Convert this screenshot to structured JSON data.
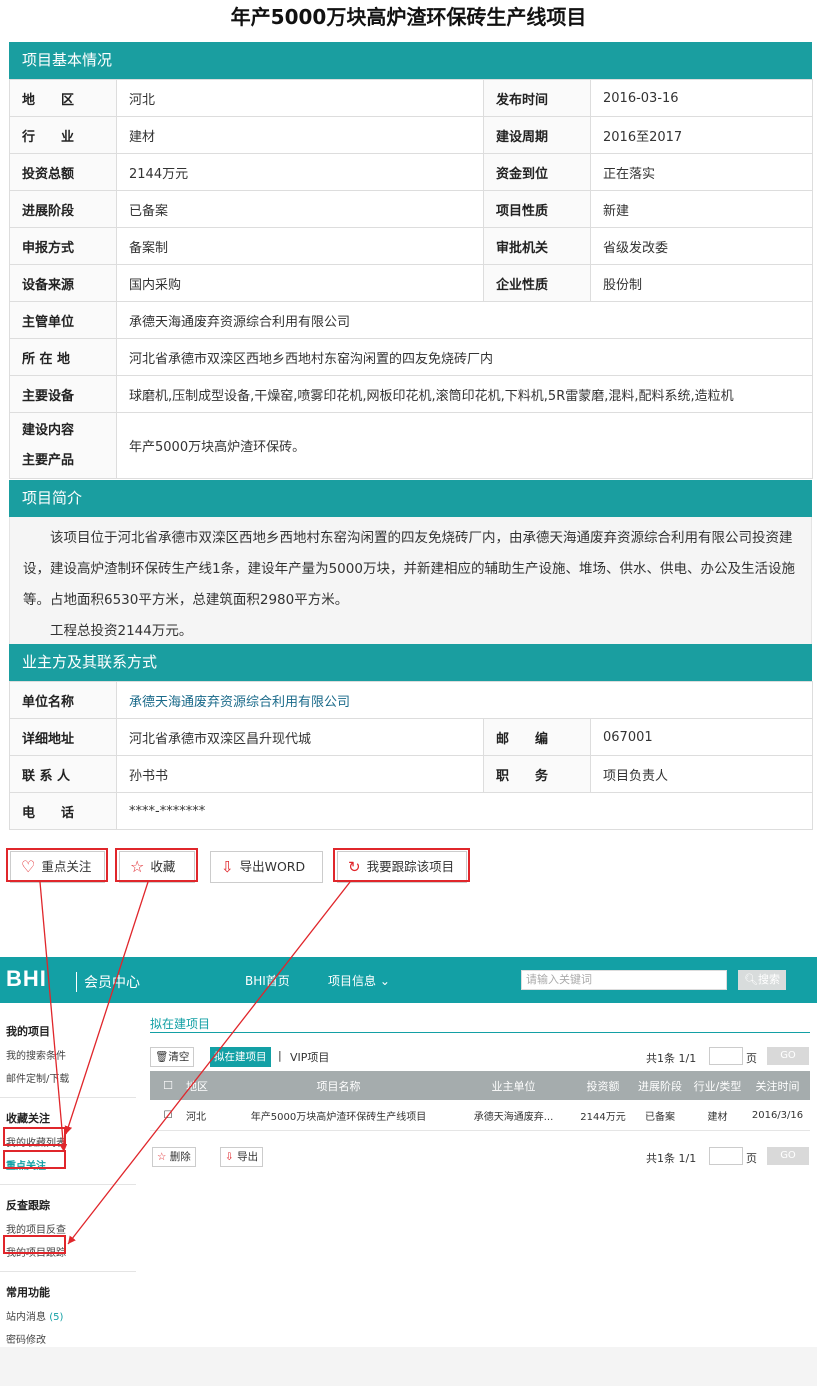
{
  "page_title": "年产5000万块高炉渣环保砖生产线项目",
  "basic": {
    "heading": "项目基本情况",
    "rows": [
      {
        "k1": "地　　区",
        "v1": "河北",
        "k2": "发布时间",
        "v2": "2016-03-16"
      },
      {
        "k1": "行　　业",
        "v1": "建材",
        "k2": "建设周期",
        "v2": "2016至2017"
      },
      {
        "k1": "投资总额",
        "v1": "2144万元",
        "k2": "资金到位",
        "v2": "正在落实"
      },
      {
        "k1": "进展阶段",
        "v1": "已备案",
        "k2": "项目性质",
        "v2": "新建"
      },
      {
        "k1": "申报方式",
        "v1": "备案制",
        "k2": "审批机关",
        "v2": "省级发改委"
      },
      {
        "k1": "设备来源",
        "v1": "国内采购",
        "k2": "企业性质",
        "v2": "股份制"
      }
    ],
    "wide": [
      {
        "k": "主管单位",
        "v": "承德天海通废弃资源综合利用有限公司"
      },
      {
        "k": "所 在 地",
        "v": "河北省承德市双滦区西地乡西地村东窑沟闲置的四友免烧砖厂内"
      },
      {
        "k": "主要设备",
        "v": "球磨机,压制成型设备,干燥窑,喷雾印花机,网板印花机,滚筒印花机,下料机,5R雷蒙磨,混料,配料系统,造粒机"
      }
    ],
    "content_k1": "建设内容",
    "content_k2": "主要产品",
    "content_v": "年产5000万块高炉渣环保砖。"
  },
  "intro": {
    "heading": "项目简介",
    "p1": "该项目位于河北省承德市双滦区西地乡西地村东窑沟闲置的四友免烧砖厂内，由承德天海通废弃资源综合利用有限公司投资建设，建设高炉渣制环保砖生产线1条，建设年产量为5000万块，并新建相应的辅助生产设施、堆场、供水、供电、办公及生活设施等。占地面积6530平方米，总建筑面积2980平方米。",
    "p2": "工程总投资2144万元。"
  },
  "owner": {
    "heading": "业主方及其联系方式",
    "unit_k": "单位名称",
    "unit_v": "承德天海通废弃资源综合利用有限公司",
    "addr_k": "详细地址",
    "addr_v": "河北省承德市双滦区昌升现代城",
    "zip_k": "邮　　编",
    "zip_v": "067001",
    "contact_k": "联 系 人",
    "contact_v": "孙书书",
    "job_k": "职　　务",
    "job_v": "项目负责人",
    "phone_k": "电　　话",
    "phone_v": "****-*******"
  },
  "actions": {
    "focus": "重点关注",
    "fav": "收藏",
    "export": "导出WORD",
    "track": "我要跟踪该项目"
  },
  "member": {
    "logo": "BHI",
    "center": "会员中心",
    "nav_home": "BHI首页",
    "nav_info": "项目信息",
    "search_placeholder": "请输入关键词",
    "search_btn": "搜索",
    "side": {
      "g1": "我的项目",
      "g1_items": [
        "我的搜索条件",
        "邮件定制/下载"
      ],
      "g2": "收藏关注",
      "g2_items": [
        "我的收藏列表",
        "重点关注"
      ],
      "g3": "反查跟踪",
      "g3_items": [
        "我的项目反查",
        "我的项目跟踪"
      ],
      "g4": "常用功能",
      "g4_items": [
        "站内消息",
        "密码修改"
      ],
      "msg_count": "(5)"
    },
    "breadcrumb": "拟在建项目",
    "clear": "清空",
    "tab_active": "拟在建项目",
    "sep": "|",
    "tab_vip": "VIP项目",
    "page_info": "共1条  1/1",
    "page_word": "页",
    "go": "GO",
    "headers": [
      "地区",
      "项目名称",
      "业主单位",
      "投资额",
      "进展阶段",
      "行业/类型",
      "关注时间"
    ],
    "row": [
      "河北",
      "年产5000万块高炉渣环保砖生产线项目",
      "承德天海通废弃...",
      "2144万元",
      "已备案",
      "建材",
      "2016/3/16"
    ],
    "delete": "删除",
    "export": "导出"
  }
}
